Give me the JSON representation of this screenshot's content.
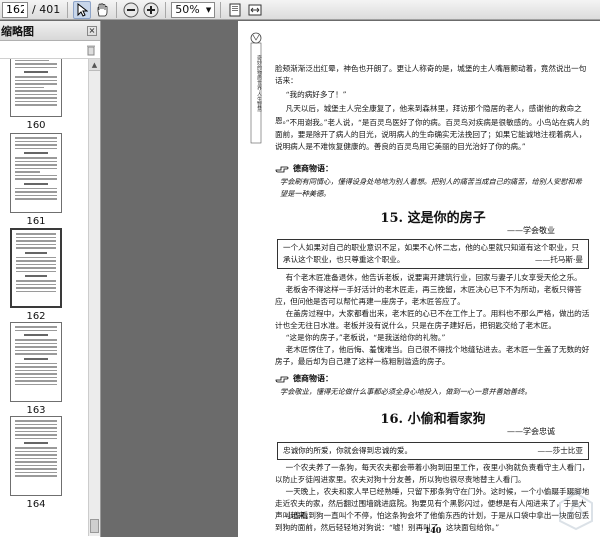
{
  "toolbar": {
    "page_current": "162",
    "page_total": "/ 401",
    "zoom": "50%"
  },
  "sidebar": {
    "title": "缩略图",
    "thumbnails": [
      {
        "label": "160"
      },
      {
        "label": "161"
      },
      {
        "label": "162"
      },
      {
        "label": "163"
      },
      {
        "label": "164"
      }
    ]
  },
  "page": {
    "banner_text": "奇妙的物质世界·人生智慧",
    "para1": "脸颊渐渐泛出红晕，神色也开朗了。更让人称奇的是，城堡的主人嘴唇颤动着，竟然说出一句话来：",
    "para2": "“我的病好多了！”",
    "para3": "凡天以后，城堡主人完全康复了，他来到森林里，拜访那个隐居的老人，感谢他的救命之恩。",
    "para4": "“不用谢我。”老人说，“是百灵鸟医好了你的病。百灵鸟对疾病是很敏感的。小鸟站在病人的面前，要是除开了病人的目光，说明病人的生命确实无法挽回了；如果它能诚地注视着病人，说明病人是不难恢复健康的。善良的百灵鸟用它美丽的目光治好了你的病。”",
    "tip1_head": "德商物语：",
    "tip1_text": "学会刷有同情心，懂得设身处地地为别人着想。把别人的痛苦当成自己的痛苦，给别人安慰和希望是一种美德。",
    "section1_title": "15. 这是你的房子",
    "section1_sub": "——学会敬业",
    "quote1_text": "一个人如果对自己的职业意识不足，如果不心怀二志，他的心里就只知道有这个职业，只承认这个职业，也只尊重这个职业。",
    "quote1_src": "——托马斯·曼",
    "para5": "有个老木匠准备退休，他告诉老板，说要离开建筑行业，回家与妻子儿女享受天伦之乐。",
    "para6": "老板舍不得这样一手好活计的老木匠走，再三挽留，木匠决心已下不为所动，老板只得答应，但问他是否可以帮忙再建一座房子，老木匠答应了。",
    "para7": "在盖房过程中，大家都看出来，老木匠的心已不在工作上了。用料也不那么严格，做出的活计也全无往日水准。老板并没有说什么，只是在房子建好后，把钥匙交给了老木匠。",
    "para8": "“这是你的房子，”老板说，“是我送给你的礼物。”",
    "para9": "老木匠愣住了，他后悔、羞愧难当。自己很不得找个地缝钻进去。老木匠一生盖了无数的好房子，最后却为自己建了这样一栋粗制滥造的房子。",
    "tip2_head": "德商物语：",
    "tip2_text": "学会敬业，懂得无论做什么事都必须全身心地投入，做到一心一意并善始善终。",
    "section2_title": "16. 小偷和看家狗",
    "section2_sub": "——学会忠诚",
    "quote2_text": "忠诚你的所爱，你就会得到忠诚的爱。",
    "quote2_src": "——莎士比亚",
    "para10": "一个农夫养了一条狗，每天农夫都会带着小狗到田里工作，夜里小狗就负责看守主人看门，以防止歹徒闯进家里。农夫对狗十分友善，所以狗也很尽责地替主人看门。",
    "para11": "一天晚上，农夫和家人早已经熟睡，只留下那条狗守在门外。这时候，一个小偷蹑手蹑脚地走近农夫的家，然后翻过围墙跳进庭院。狗要见有个黑影闪过，便想是有人闯进来了，于是大声叫起来。",
    "para12": "小偷看到狗一直叫个不停，怕这条狗会坏了他偷东西的计划，于是从口袋中拿出一块面包丢到狗的面前，然后轻轻地对狗说：“嘘！别再叫了，这块面包给你。”",
    "page_number": "140"
  }
}
